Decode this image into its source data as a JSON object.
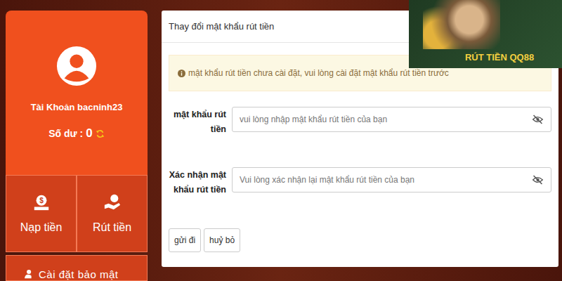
{
  "account": {
    "label": "Tài Khoản bacninh23",
    "balance_label": "Số dư :",
    "balance": "0"
  },
  "actions": [
    {
      "label": "Nạp tiền",
      "kind": "deposit"
    },
    {
      "label": "Rút tiền",
      "kind": "withdraw"
    }
  ],
  "security": {
    "label": "Cài đặt bảo mật"
  },
  "panel": {
    "title": "Thay đổi mật khẩu rút tiền",
    "notice": "mật khẩu rút tiền chưa cài đặt, vui lòng cài đặt mật khẩu rút tiền trước",
    "fields": [
      {
        "label": "mật khẩu rút tiền",
        "placeholder": "vui lòng nhập mật khẩu rút tiền của bạn"
      },
      {
        "label": "Xác nhận mật khẩu rút tiền",
        "placeholder": "Vui lòng xác nhận lại mật khẩu rút tiền của bạn"
      }
    ],
    "buttons": [
      "gửi đi",
      "huỷ bỏ"
    ]
  },
  "banner": {
    "text": "RÚT TIỀN QQ88"
  }
}
